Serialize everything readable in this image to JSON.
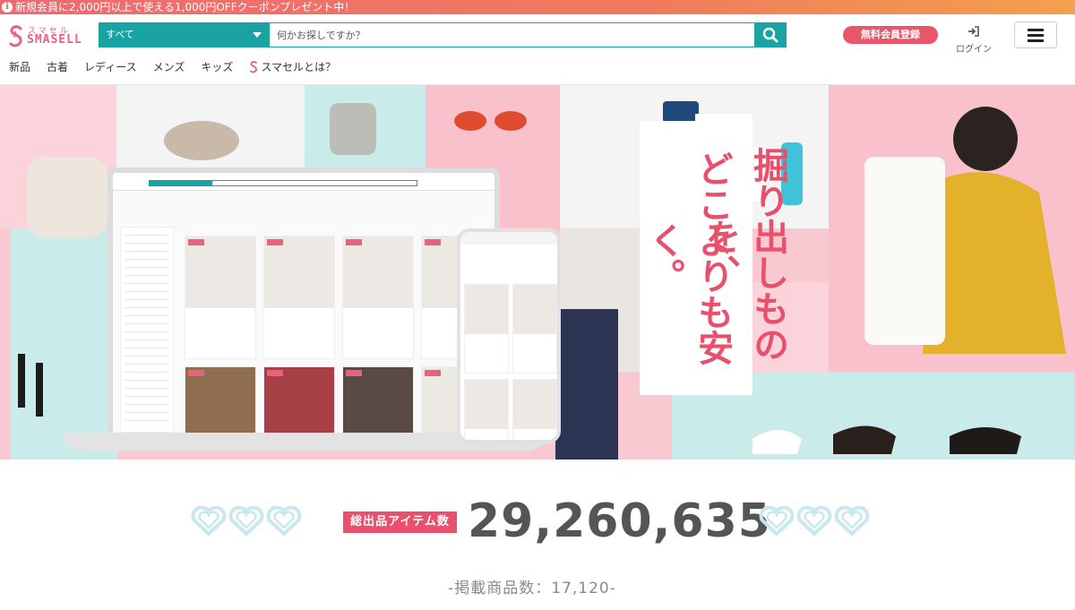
{
  "promo": {
    "text": "新規会員に2,000円以上で使える1,000円OFFクーポンプレゼント中！",
    "info_glyph": "i"
  },
  "header": {
    "logo_kana": "スマセル",
    "logo_word": "SMASELL",
    "search": {
      "category": "すべて",
      "placeholder": "何かお探しですか？"
    },
    "register_label": "無料会員登録",
    "login_label": "ログイン"
  },
  "nav": {
    "items": [
      "新品",
      "古着",
      "レディース",
      "メンズ",
      "キッズ",
      "スマセルとは？"
    ]
  },
  "hero": {
    "catch_line1": "掘り出しものを、",
    "catch_line2": "どこよりも安く。"
  },
  "stats": {
    "badge": "総出品アイテム数",
    "total_items": "29,260,635",
    "listed_count": "-掲載商品数：17,120-"
  },
  "colors": {
    "brand_pink": "#e8506b",
    "teal": "#1aa3a3",
    "heart_blue": "#c9e8ee"
  }
}
